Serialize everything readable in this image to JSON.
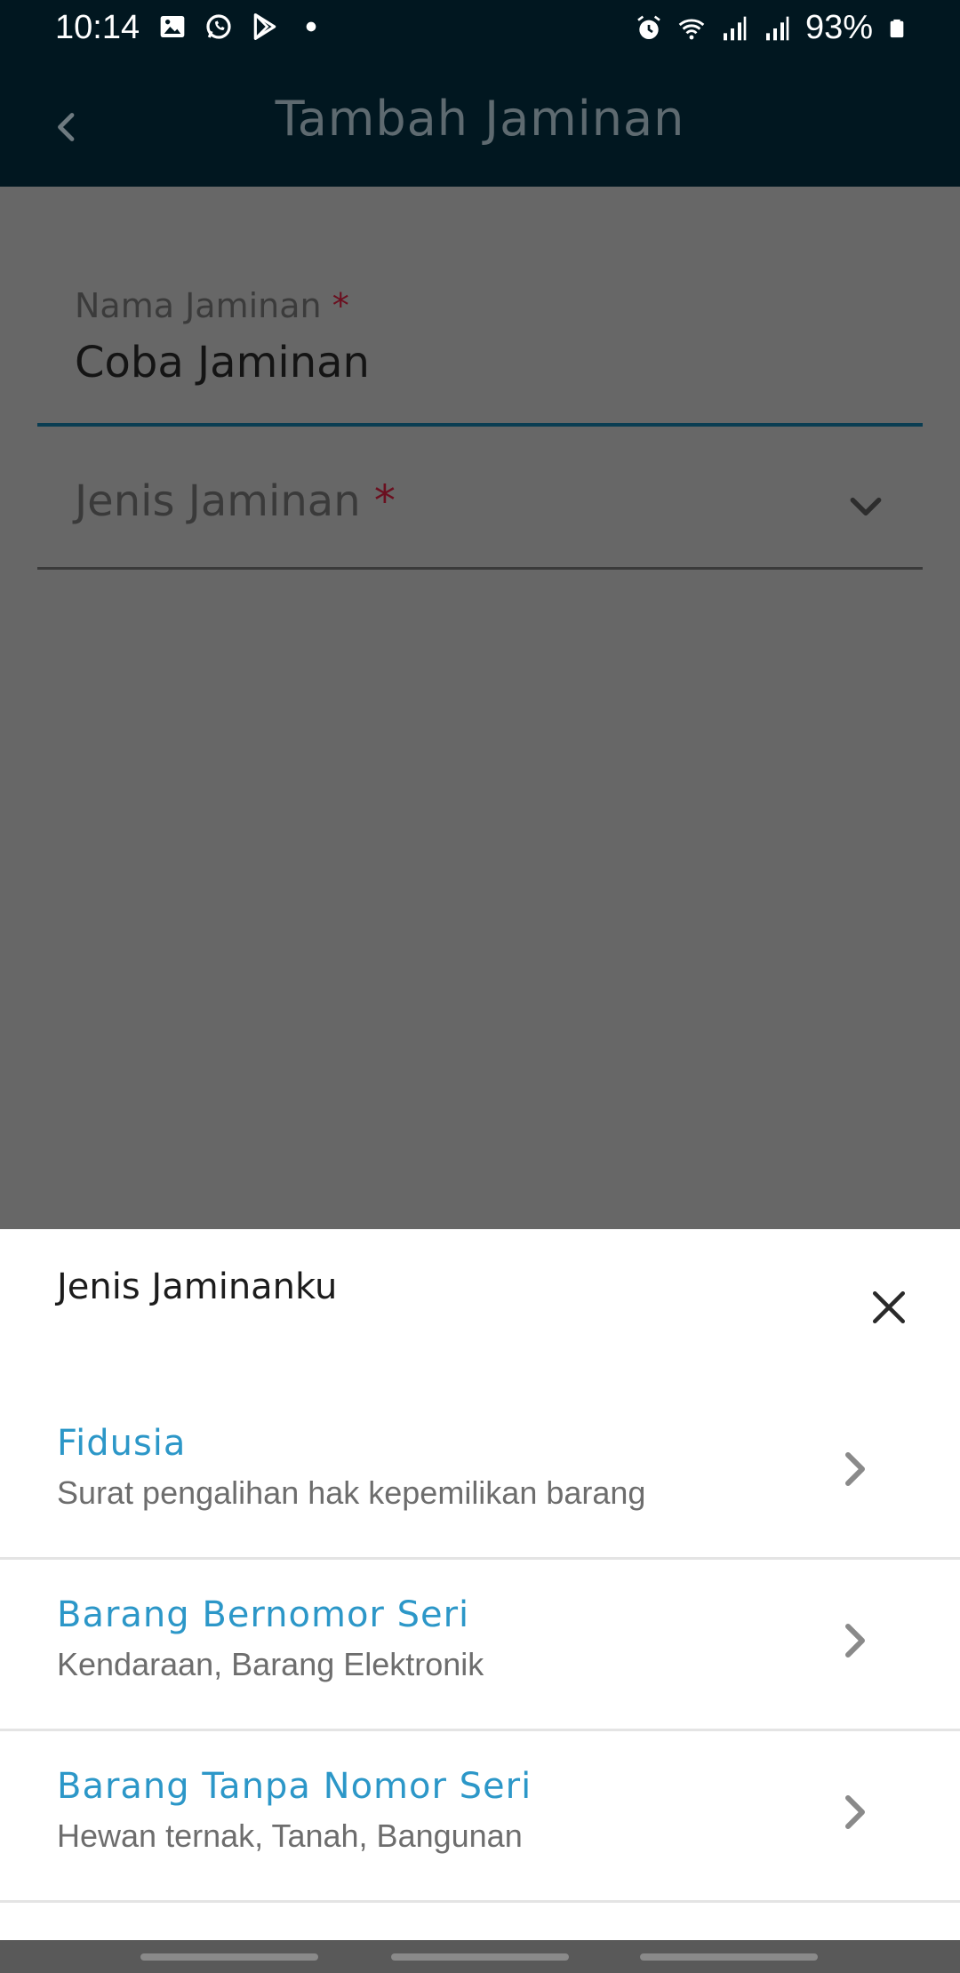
{
  "status_bar": {
    "time": "10:14",
    "battery": "93%",
    "left_icons": [
      "gallery-icon",
      "whatsapp-icon",
      "play-store-icon",
      "dot-icon"
    ],
    "right_icons": [
      "alarm-icon",
      "wifi-icon",
      "signal-icon",
      "signal-icon",
      "battery-icon"
    ]
  },
  "app_bar": {
    "title": "Tambah Jaminan",
    "back_icon": "chevron-left-icon"
  },
  "form": {
    "nama_jaminan": {
      "label": "Nama Jaminan",
      "required_mark": "*",
      "value": "Coba Jaminan"
    },
    "jenis_jaminan": {
      "label": "Jenis Jaminan",
      "required_mark": "*",
      "icon": "chevron-down-icon"
    }
  },
  "sheet": {
    "title": "Jenis Jaminanku",
    "close_icon": "close-icon",
    "options": [
      {
        "title": "Fidusia",
        "subtitle": "Surat pengalihan hak kepemilikan barang"
      },
      {
        "title": "Barang Bernomor Seri",
        "subtitle": "Kendaraan, Barang Elektronik"
      },
      {
        "title": "Barang Tanpa Nomor Seri",
        "subtitle": "Hewan ternak, Tanah, Bangunan"
      }
    ]
  },
  "colors": {
    "app_bar_bg": "#011720",
    "overlay_bg": "#676767",
    "option_title": "#2c97c8",
    "required": "#6b0f1f",
    "focus_underline": "#0a3d52"
  }
}
